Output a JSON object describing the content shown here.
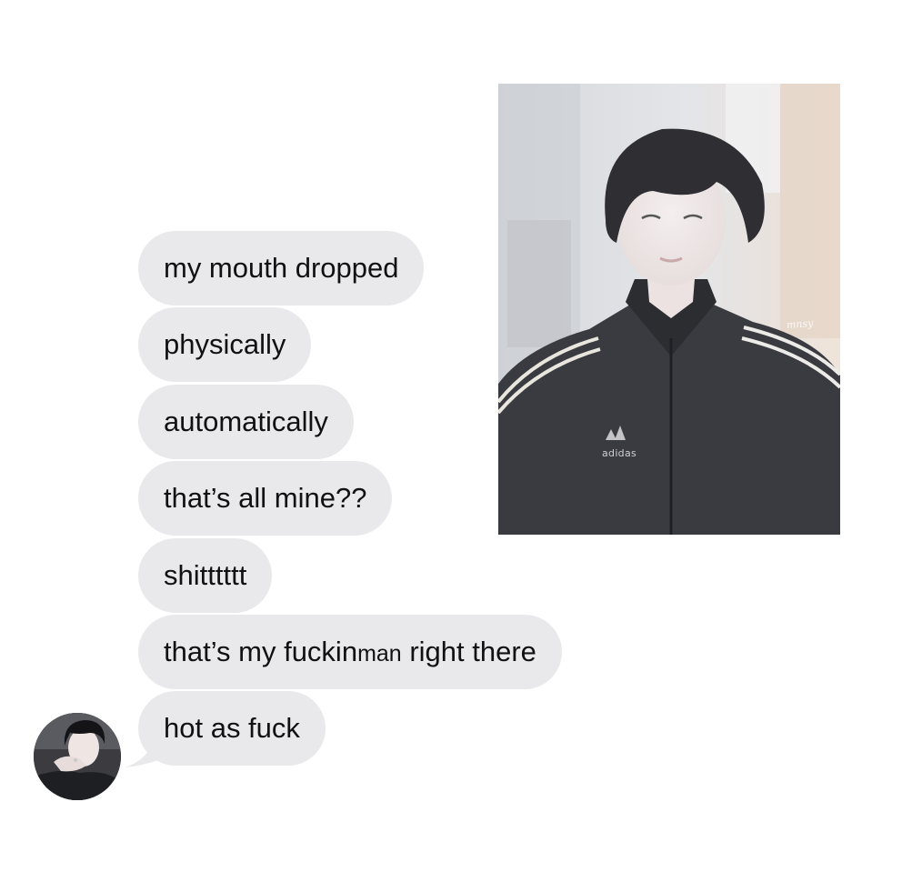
{
  "photo": {
    "watermark": "mnsy",
    "jacket_brand": "adidas"
  },
  "messages": [
    {
      "text": "my mouth dropped"
    },
    {
      "text": "physically"
    },
    {
      "text": "automatically"
    },
    {
      "text": "that’s all mine??"
    },
    {
      "text": "shitttttt"
    },
    {
      "text_before": "that’s my fuckin",
      "text_small": "man",
      "text_after": " right there"
    },
    {
      "text": "hot as fuck"
    }
  ],
  "colors": {
    "bubble": "#e9e9eb",
    "text": "#111111",
    "background": "#ffffff"
  },
  "avatar": {
    "icon": "avatar-photo"
  }
}
